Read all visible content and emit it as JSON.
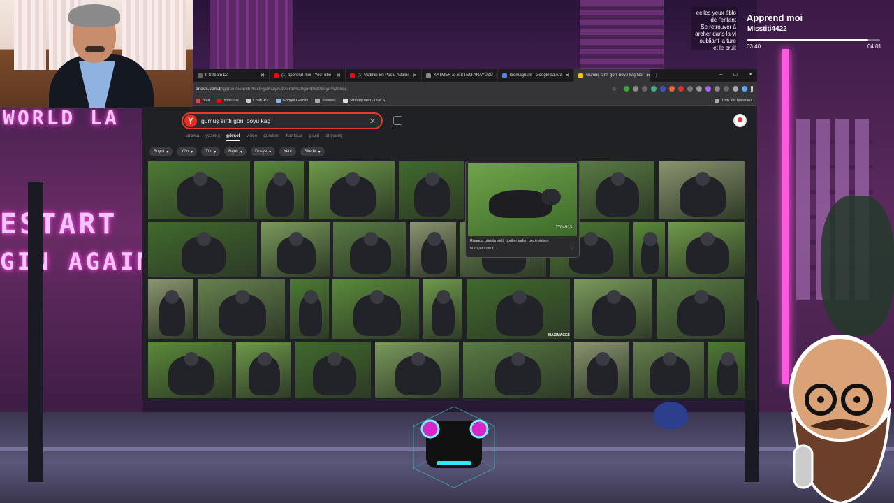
{
  "webcam": {
    "label": "webcam-feed"
  },
  "now_playing": {
    "art_text": "ec les yeux éblo\nde l'enfant\nSe retrouver à\narcher dans la vi\noubliant la ture\net le bruit",
    "title": "Apprend moi",
    "artist": "Misstiti4422",
    "elapsed": "03:40",
    "duration": "04:01",
    "progress": 0.91
  },
  "background": {
    "sign_top": "WORLD LA",
    "sign_mid": "ESTART",
    "sign_low": "GIN AGAIN"
  },
  "browser": {
    "tabs": [
      {
        "label": "li-Stream Da",
        "color": "#666"
      },
      {
        "label": "(1) apprend moi - YouTube",
        "color": "#f00"
      },
      {
        "label": "(1) Vadinin En Puslu Adamı",
        "color": "#f00"
      },
      {
        "label": "KATMER /// SİSTEM ARAYÜZÜ",
        "color": "#888"
      },
      {
        "label": "kromagnum - Google'da Ara",
        "color": "#4285f4"
      },
      {
        "label": "Gümüş sırtlı goril boyu kaç Gör",
        "color": "#f5c400",
        "active": true
      }
    ],
    "new_tab": "+",
    "window_controls": [
      "–",
      "□",
      "✕"
    ],
    "url_domain": "andex.com.tr",
    "url_path": "/gorsel/search?text=gümüş%20sırtlı%20goril%20boyu%20kaç",
    "bookmarks": [
      {
        "label": "mail",
        "color": "#d44"
      },
      {
        "label": "YouTube",
        "color": "#f00"
      },
      {
        "label": "ChatGPT",
        "color": "#ccc"
      },
      {
        "label": "Google Gemini",
        "color": "#8ab4f8"
      },
      {
        "label": "sssssss",
        "color": "#aaa"
      },
      {
        "label": "StreamDash - Live S...",
        "color": "#ddd"
      }
    ],
    "all_bookmarks": "Tüm Yer İşaretleri"
  },
  "search": {
    "logo": "Y",
    "query": "gümüş sırtlı goril boyu kaç",
    "clear": "✕",
    "tabs": [
      {
        "label": "arama"
      },
      {
        "label": "yazeka"
      },
      {
        "label": "görsel",
        "active": true
      },
      {
        "label": "video"
      },
      {
        "label": "gündem"
      },
      {
        "label": "haritalar"
      },
      {
        "label": "çeviri"
      },
      {
        "label": "alışveriş"
      }
    ],
    "filters": [
      "Boyut",
      "Yön",
      "Tür",
      "Renk",
      "Dosya",
      "Yeni",
      "Sitede"
    ]
  },
  "hover_card": {
    "dimensions": "770×513",
    "title": "Ruanda gümüş sırtlı goriller safari gezi rehberi",
    "source": "hurriyet.com.tr",
    "more": "⋮"
  },
  "watermark": "MAXIMAGES",
  "colors": {
    "accent": "#e73a2a",
    "browser_bg": "#202124",
    "neon_pink": "#ff4fd8"
  },
  "icons": [
    "search-icon",
    "camera-lens-icon",
    "close-icon",
    "chevron-down-icon",
    "star-icon",
    "download-icon",
    "menu-icon"
  ]
}
